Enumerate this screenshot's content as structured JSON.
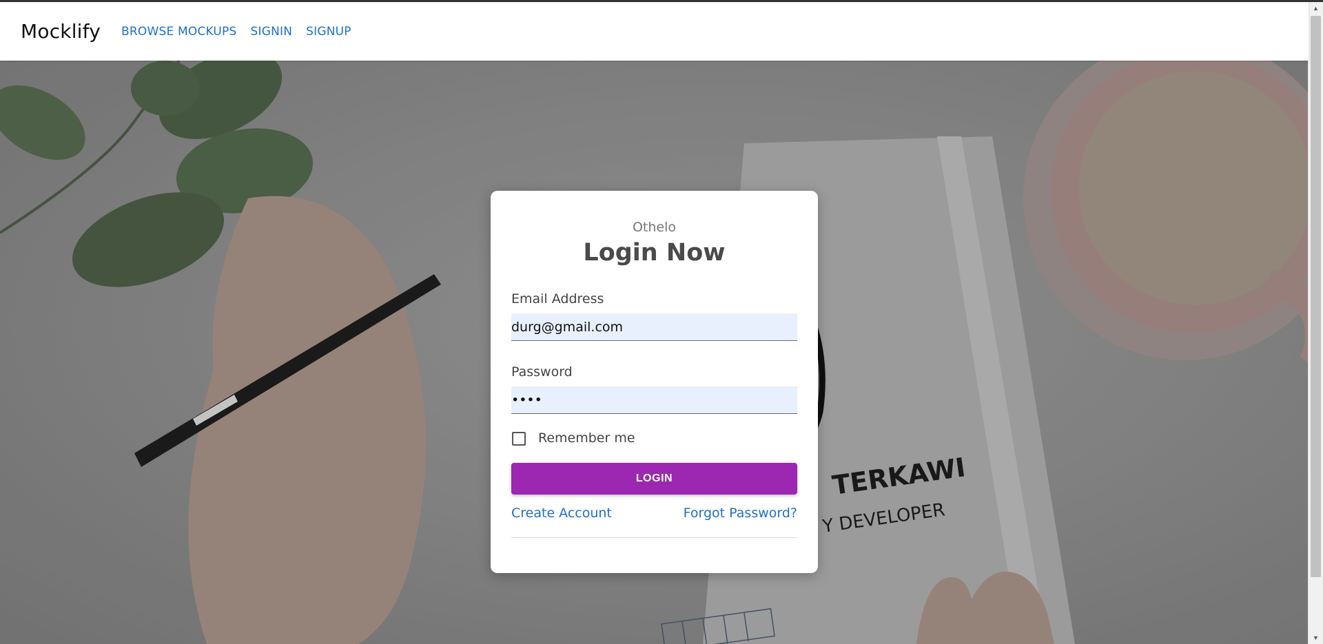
{
  "nav": {
    "brand": "Mocklify",
    "links": [
      "BROWSE MOCKUPS",
      "SIGNIN",
      "SIGNUP"
    ]
  },
  "background": {
    "notebook_text_1": "TERKAWI",
    "notebook_text_2": "Y DEVELOPER"
  },
  "login": {
    "subtitle": "Othelo",
    "title": "Login Now",
    "email_label": "Email Address",
    "email_value": "durg@gmail.com",
    "password_label": "Password",
    "password_value": "••••",
    "remember_label": "Remember me",
    "remember_checked": false,
    "login_button": "LOGIN",
    "create_account": "Create Account",
    "forgot_password": "Forgot Password?"
  },
  "colors": {
    "accent": "#9c27b0",
    "link": "#1f6fd1",
    "field_bg": "#e8f0fe"
  },
  "icons": {
    "scroll_up": "chevron-up-icon",
    "scroll_down": "chevron-down-icon"
  }
}
